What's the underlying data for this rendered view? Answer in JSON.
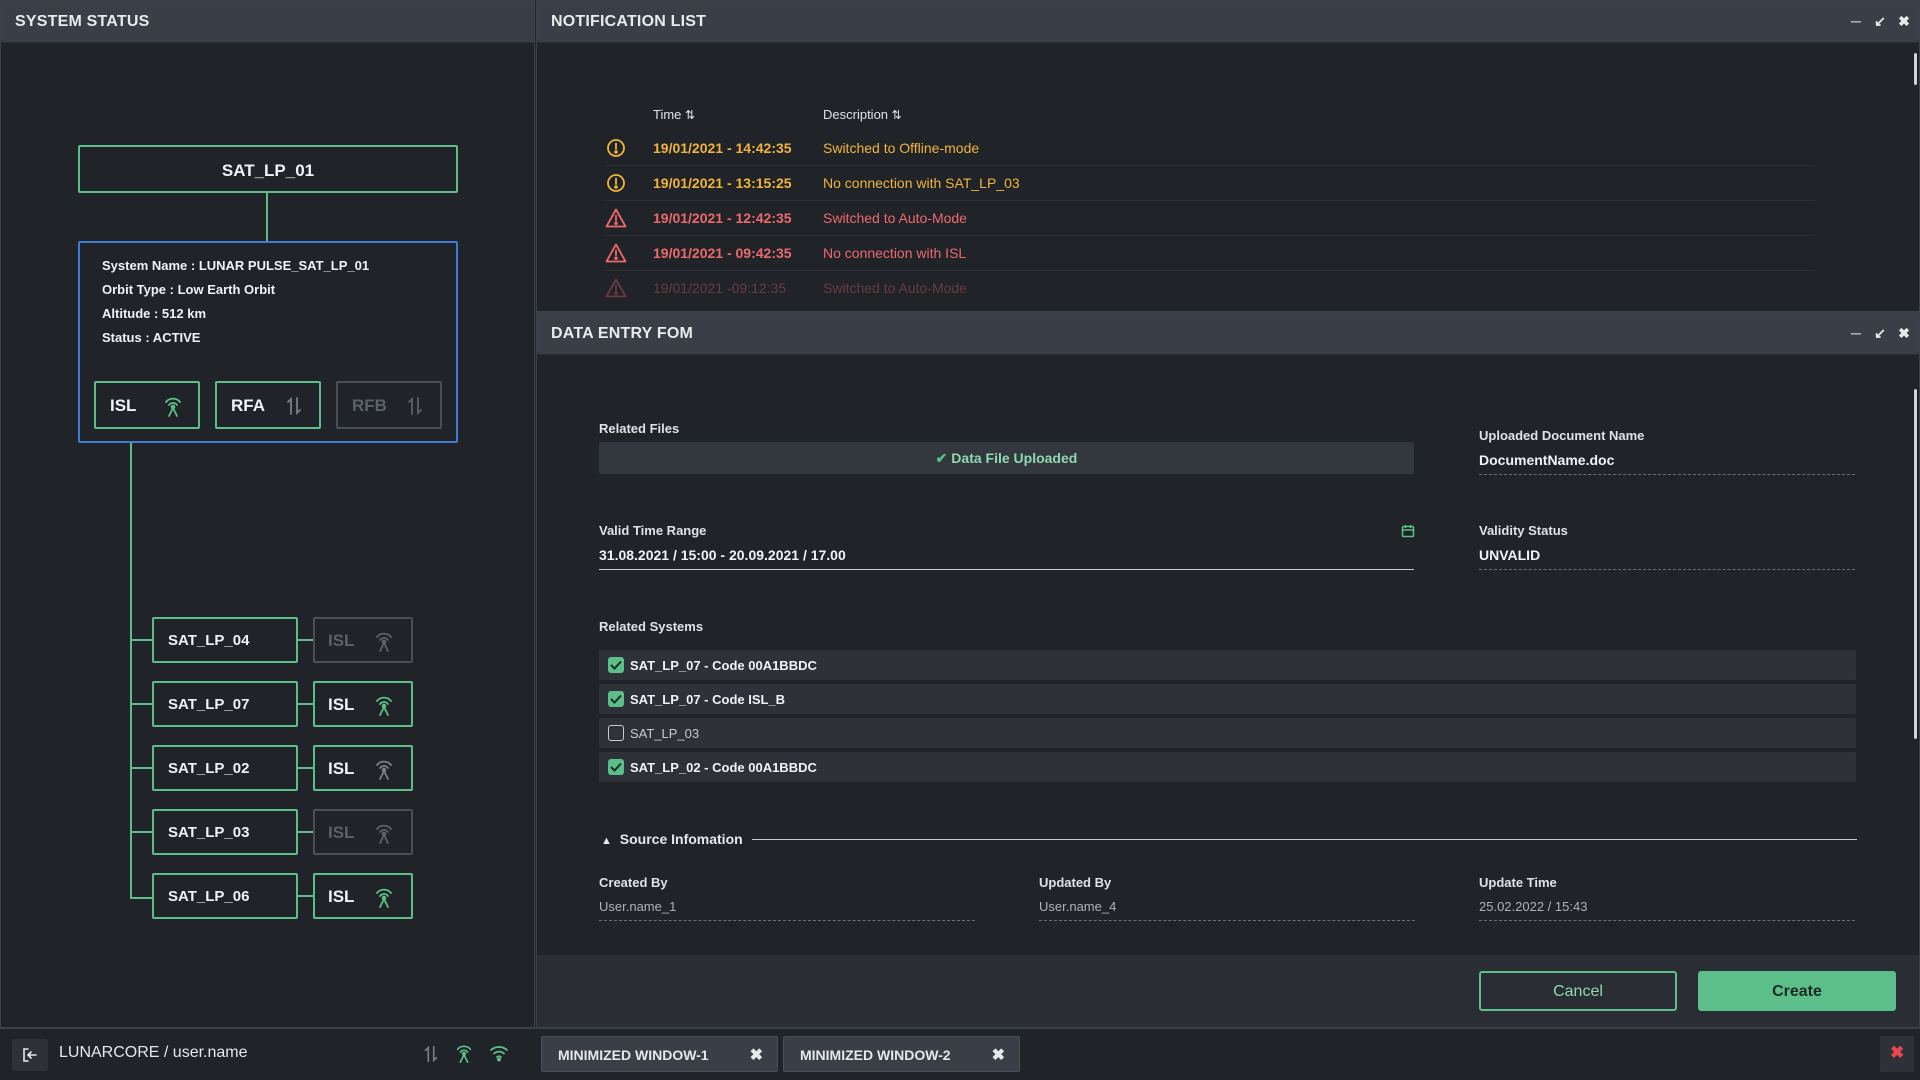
{
  "system_status": {
    "title": "SYSTEM STATUS",
    "root_node": "SAT_LP_01",
    "info": {
      "system_name": "System Name : LUNAR PULSE_SAT_LP_01",
      "orbit_type": "Orbit Type : Low Earth Orbit",
      "altitude": "Altitude : 512 km",
      "status": "Status : ACTIVE"
    },
    "chips": [
      {
        "label": "ISL",
        "icon": "antenna-icon",
        "active": true
      },
      {
        "label": "RFA",
        "icon": "transfer-arrows-icon",
        "active": true
      },
      {
        "label": "RFB",
        "icon": "transfer-arrows-icon",
        "active": false
      }
    ],
    "satellites": [
      {
        "name": "SAT_LP_04",
        "link": "ISL",
        "active": false
      },
      {
        "name": "SAT_LP_07",
        "link": "ISL",
        "active": true
      },
      {
        "name": "SAT_LP_02",
        "link": "ISL",
        "active": true
      },
      {
        "name": "SAT_LP_03",
        "link": "ISL",
        "active": false
      },
      {
        "name": "SAT_LP_06",
        "link": "ISL",
        "active": true
      }
    ]
  },
  "notification_list": {
    "title": "NOTIFICATION LIST",
    "col_time": "Time",
    "col_description": "Description",
    "rows": [
      {
        "time": "19/01/2021 - 14:42:35",
        "description": "Switched to Offline-mode",
        "severity": "warning"
      },
      {
        "time": "19/01/2021 - 13:15:25",
        "description": "No connection with SAT_LP_03",
        "severity": "warning"
      },
      {
        "time": "19/01/2021 - 12:42:35",
        "description": "Switched to Auto-Mode",
        "severity": "alert"
      },
      {
        "time": "19/01/2021 - 09:42:35",
        "description": "No connection with ISL",
        "severity": "alert"
      },
      {
        "time": "19/01/2021 -09:12:35",
        "description": "Switched to Auto-Mode",
        "severity": "alert"
      }
    ]
  },
  "data_entry": {
    "title": "DATA ENTRY FOM",
    "related_files_label": "Related Files",
    "upload_status": "Data File Uploaded",
    "uploaded_doc_label": "Uploaded Document Name",
    "uploaded_doc_value": "DocumentName.doc",
    "valid_time_label": "Valid Time Range",
    "valid_time_value": "31.08.2021 / 15:00 - 20.09.2021 / 17.00",
    "validity_label": "Validity Status",
    "validity_value": "UNVALID",
    "related_systems_label": "Related Systems",
    "related_systems": [
      {
        "label": "SAT_LP_07 - Code 00A1BBDC",
        "checked": true
      },
      {
        "label": "SAT_LP_07 - Code ISL_B",
        "checked": true
      },
      {
        "label": "SAT_LP_03",
        "checked": false
      },
      {
        "label": "SAT_LP_02 - Code 00A1BBDC",
        "checked": true
      }
    ],
    "source_section_label": "Source Infomation",
    "created_by_label": "Created By",
    "created_by_value": "User.name_1",
    "updated_by_label": "Updated By",
    "updated_by_value": "User.name_4",
    "update_time_label": "Update Time",
    "update_time_value": "25.02.2022 / 15:43",
    "cancel_label": "Cancel",
    "create_label": "Create"
  },
  "taskbar": {
    "user": "LUNARCORE / user.name",
    "minimized": [
      "MINIMIZED WINDOW-1",
      "MINIMIZED WINDOW-2"
    ]
  },
  "colors": {
    "accent_green": "#5cbf8a",
    "warning": "#f0b43c",
    "alert": "#ec6a6e",
    "info_border": "#3d7bd6",
    "close_red": "#e8474d"
  }
}
